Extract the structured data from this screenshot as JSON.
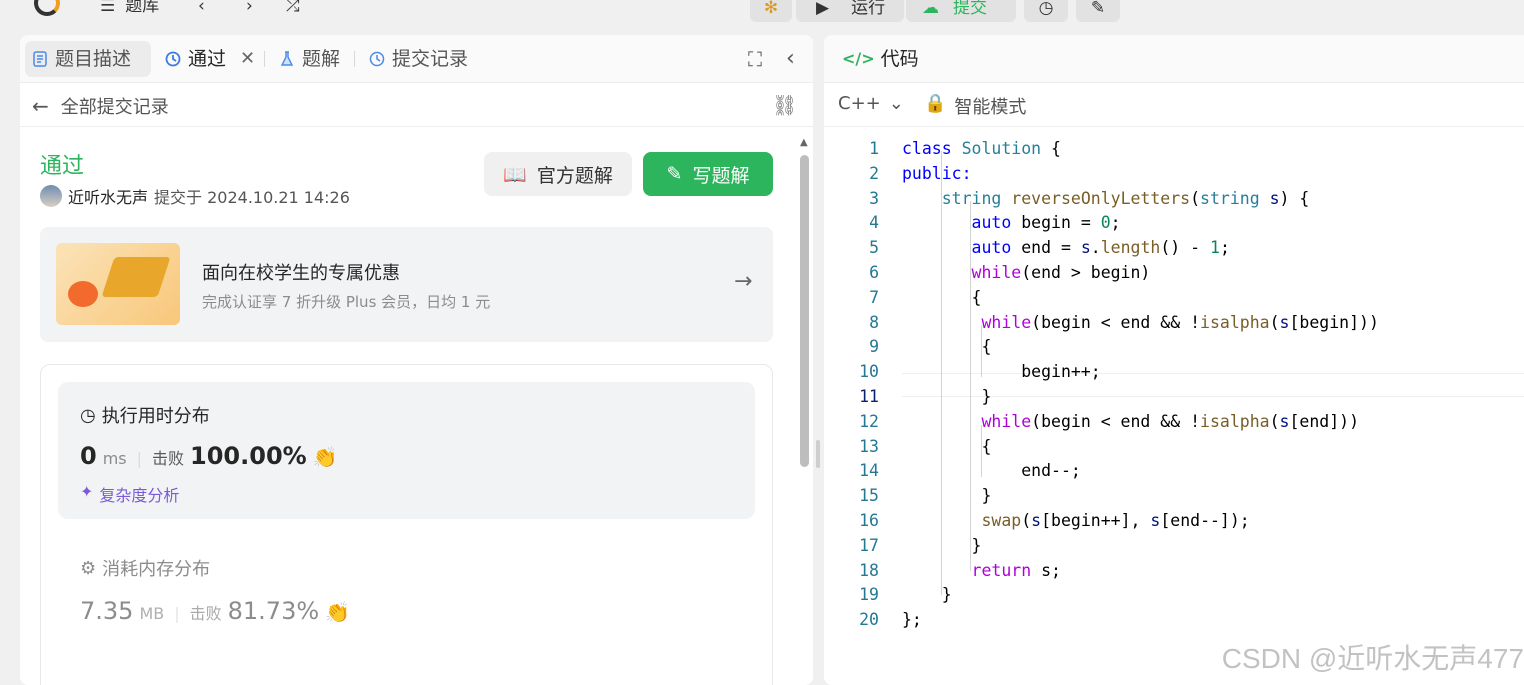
{
  "topbar": {
    "library_label": "题库",
    "run_label": "运行",
    "submit_label": "提交"
  },
  "left_tabs": [
    {
      "label": "题目描述"
    },
    {
      "label": "通过"
    },
    {
      "label": "题解"
    },
    {
      "label": "提交记录"
    }
  ],
  "subhead": {
    "back_label": "全部提交记录"
  },
  "submission": {
    "status": "通过",
    "user": "近听水无声",
    "submitted_at": "提交于 2024.10.21 14:26",
    "official_solution_label": "官方题解",
    "write_solution_label": "写题解"
  },
  "promo": {
    "title": "面向在校学生的专属优惠",
    "subtitle": "完成认证享 7 折升级 Plus 会员，日均 1 元"
  },
  "runtime": {
    "title": "执行用时分布",
    "value": "0",
    "unit": "ms",
    "beats_label": "击败",
    "beats": "100.00%",
    "complexity_label": "复杂度分析"
  },
  "memory": {
    "title": "消耗内存分布",
    "value": "7.35",
    "unit": "MB",
    "beats_label": "击败",
    "beats": "81.73%"
  },
  "editor": {
    "title": "代码",
    "language": "C++",
    "mode": "智能模式",
    "active_line": 11
  },
  "code_lines": [
    [
      {
        "t": "class ",
        "c": "kw"
      },
      {
        "t": "Solution",
        "c": "ty"
      },
      {
        "t": " {",
        "c": ""
      }
    ],
    [
      {
        "t": "public:",
        "c": "kw"
      }
    ],
    [
      {
        "t": "    ",
        "c": ""
      },
      {
        "t": "string",
        "c": "ty"
      },
      {
        "t": " ",
        "c": ""
      },
      {
        "t": "reverseOnlyLetters",
        "c": "fn"
      },
      {
        "t": "(",
        "c": ""
      },
      {
        "t": "string",
        "c": "ty"
      },
      {
        "t": " ",
        "c": ""
      },
      {
        "t": "s",
        "c": "vr"
      },
      {
        "t": ") {",
        "c": ""
      }
    ],
    [
      {
        "t": "       ",
        "c": ""
      },
      {
        "t": "auto",
        "c": "kw"
      },
      {
        "t": " begin = ",
        "c": ""
      },
      {
        "t": "0",
        "c": "nm"
      },
      {
        "t": ";",
        "c": ""
      }
    ],
    [
      {
        "t": "       ",
        "c": ""
      },
      {
        "t": "auto",
        "c": "kw"
      },
      {
        "t": " end = ",
        "c": ""
      },
      {
        "t": "s",
        "c": "vr"
      },
      {
        "t": ".",
        "c": ""
      },
      {
        "t": "length",
        "c": "fn"
      },
      {
        "t": "() - ",
        "c": ""
      },
      {
        "t": "1",
        "c": "nm"
      },
      {
        "t": ";",
        "c": ""
      }
    ],
    [
      {
        "t": "       ",
        "c": ""
      },
      {
        "t": "while",
        "c": "ctl"
      },
      {
        "t": "(end > begin)",
        "c": ""
      }
    ],
    [
      {
        "t": "       {",
        "c": ""
      }
    ],
    [
      {
        "t": "        ",
        "c": ""
      },
      {
        "t": "while",
        "c": "ctl"
      },
      {
        "t": "(begin < end && !",
        "c": ""
      },
      {
        "t": "isalpha",
        "c": "fn"
      },
      {
        "t": "(",
        "c": ""
      },
      {
        "t": "s",
        "c": "vr"
      },
      {
        "t": "[begin]))",
        "c": ""
      }
    ],
    [
      {
        "t": "        {",
        "c": ""
      }
    ],
    [
      {
        "t": "            begin++;",
        "c": ""
      }
    ],
    [
      {
        "t": "        }",
        "c": ""
      }
    ],
    [
      {
        "t": "        ",
        "c": ""
      },
      {
        "t": "while",
        "c": "ctl"
      },
      {
        "t": "(begin < end && !",
        "c": ""
      },
      {
        "t": "isalpha",
        "c": "fn"
      },
      {
        "t": "(",
        "c": ""
      },
      {
        "t": "s",
        "c": "vr"
      },
      {
        "t": "[end]))",
        "c": ""
      }
    ],
    [
      {
        "t": "        {",
        "c": ""
      }
    ],
    [
      {
        "t": "            end--;",
        "c": ""
      }
    ],
    [
      {
        "t": "        }",
        "c": ""
      }
    ],
    [
      {
        "t": "        ",
        "c": ""
      },
      {
        "t": "swap",
        "c": "fn"
      },
      {
        "t": "(",
        "c": ""
      },
      {
        "t": "s",
        "c": "vr"
      },
      {
        "t": "[begin++], ",
        "c": ""
      },
      {
        "t": "s",
        "c": "vr"
      },
      {
        "t": "[end--]);",
        "c": ""
      }
    ],
    [
      {
        "t": "       }",
        "c": ""
      }
    ],
    [
      {
        "t": "       ",
        "c": ""
      },
      {
        "t": "return",
        "c": "ctl"
      },
      {
        "t": " s;",
        "c": ""
      }
    ],
    [
      {
        "t": "    }",
        "c": ""
      }
    ],
    [
      {
        "t": "};",
        "c": ""
      }
    ]
  ],
  "watermark": "CSDN @近听水无声477"
}
